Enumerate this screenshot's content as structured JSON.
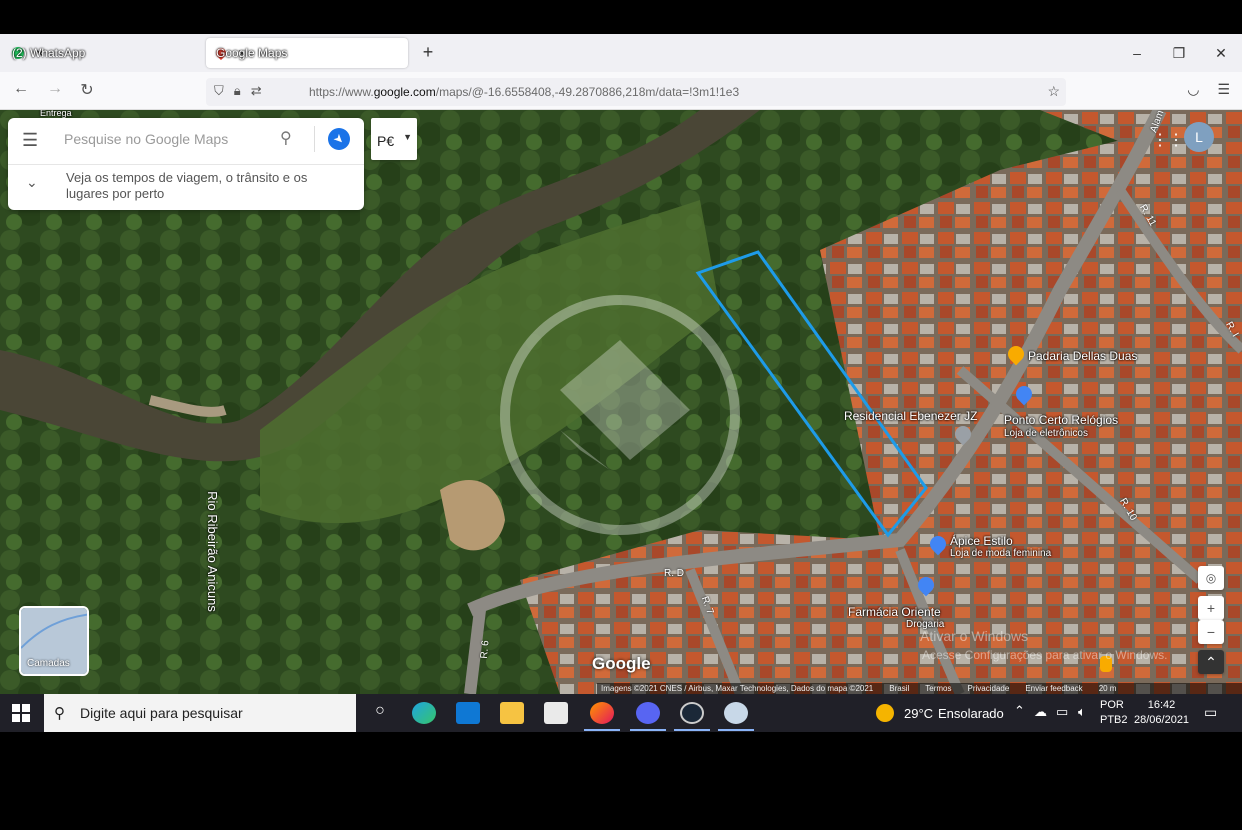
{
  "browser": {
    "tabs": [
      {
        "label": "(2) WhatsApp",
        "favicon_color": "#25d366",
        "active": false
      },
      {
        "label": "Google Maps",
        "favicon_color": "#ea4335",
        "active": true
      }
    ],
    "close_glyph": "×",
    "new_tab_glyph": "+",
    "window_controls": {
      "minimize": "–",
      "maximize": "❐",
      "close": "✕"
    },
    "nav": {
      "back": "←",
      "forward": "→",
      "reload": "↻"
    },
    "url": {
      "prefix": "https://www.",
      "host": "google.com",
      "path": "/maps/@-16.6558408,-49.2870886,218m/data=!3m1!1e3"
    },
    "url_icons": [
      "shield-icon",
      "lock-icon",
      "permissions-icon"
    ],
    "bookmark_glyph": "☆",
    "right_icons": [
      "pocket-icon",
      "menu-icon"
    ]
  },
  "maps": {
    "search": {
      "placeholder": "Pesquise no Google Maps",
      "hint": "Veja os tempos de viagem, o trânsito e os lugares por perto"
    },
    "top_button": "P€",
    "account_initial": "L",
    "places": [
      {
        "name": "Padaria Dellas Duas",
        "sub": "",
        "pin_color": "#f9ab00"
      },
      {
        "name": "Ponto Certo Relógios",
        "sub": "Loja de eletrônicos",
        "pin_color": "#4285f4"
      },
      {
        "name": "Residencial Ebenezer JZ",
        "sub": "",
        "pin_color": "#9aa0a6"
      },
      {
        "name": "Ápice Estilo",
        "sub": "Loja de moda feminina",
        "pin_color": "#4285f4"
      },
      {
        "name": "Farmácia Oriente",
        "sub": "Drogaria",
        "pin_color": "#4285f4"
      }
    ],
    "roads": [
      "R. D",
      "R. 7",
      "R. 6",
      "R. 10",
      "R. 11",
      "R. I",
      "Alam"
    ],
    "river": "Rio Ribeirão Anicuns",
    "top_left_snippet": "Entrega",
    "layers_label": "Camadas",
    "logo": "Google",
    "windows_watermark": {
      "line1": "Ativar o Windows",
      "line2": "Acesse Configurações para ativar o Windows."
    },
    "footer": {
      "imagery": "Imagens ©2021 CNES / Airbus, Maxar Technologies, Dados do mapa ©2021",
      "country": "Brasil",
      "terms": "Termos",
      "privacy": "Privacidade",
      "feedback": "Enviar feedback",
      "scale": "20 m"
    },
    "controls": {
      "zoom_in": "+",
      "zoom_out": "−",
      "expand": "⌃"
    },
    "outline_color": "#1e9be8"
  },
  "taskbar": {
    "search_text": "Digite aqui para pesquisar",
    "weather": {
      "temp": "29°C",
      "desc": "Ensolarado"
    },
    "lang": {
      "line1": "POR",
      "line2": "PTB2"
    },
    "clock": {
      "time": "16:42",
      "date": "28/06/2021"
    },
    "apps": [
      "task-view-icon",
      "edge-icon",
      "mail-icon",
      "file-explorer-icon",
      "store-icon",
      "firefox-icon",
      "discord-icon",
      "steam-icon",
      "paint-icon"
    ]
  }
}
